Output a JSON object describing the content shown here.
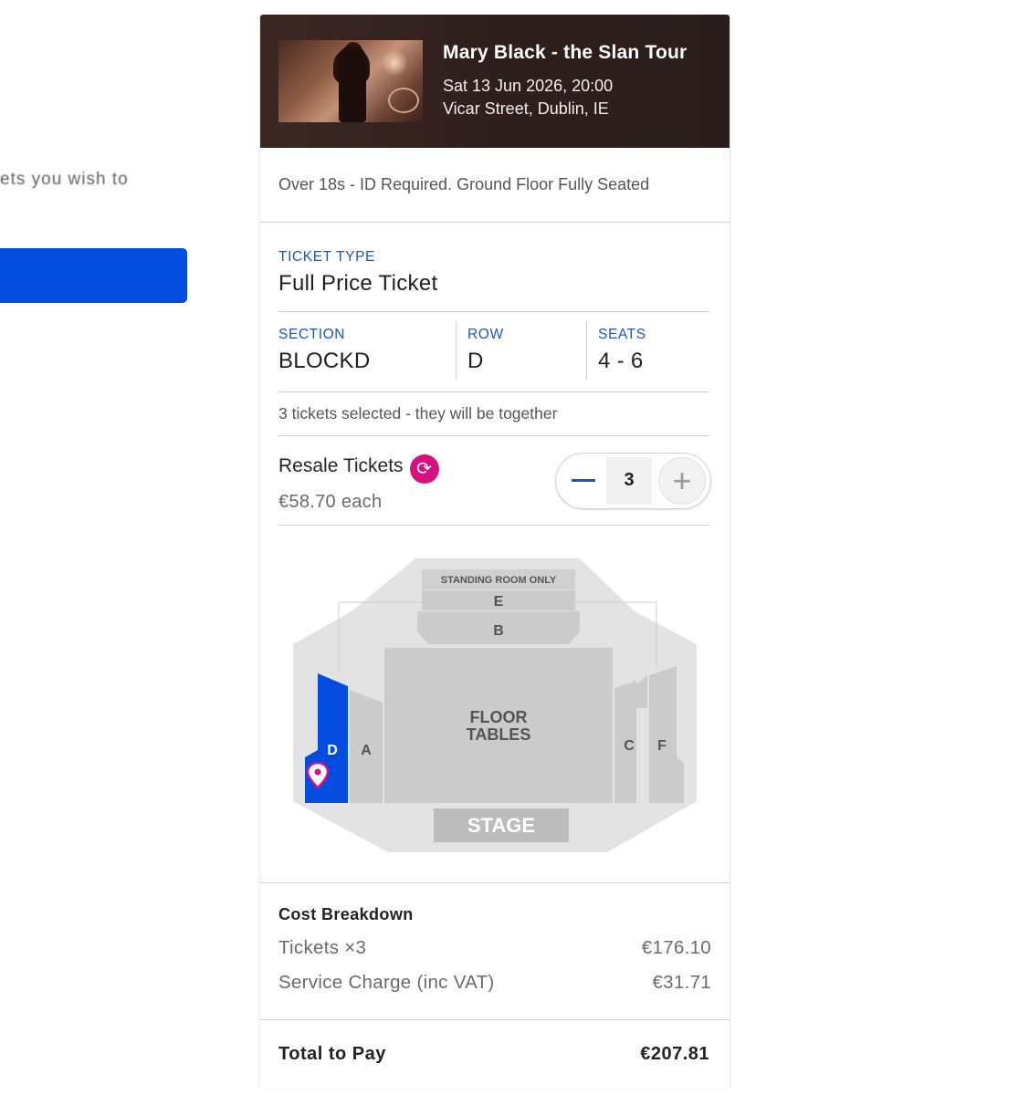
{
  "background": {
    "partial_text": "ets you wish to"
  },
  "event": {
    "title": "Mary Black - the Slan Tour",
    "date": "Sat 13 Jun 2026, 20:00",
    "venue": "Vicar Street, Dublin, IE"
  },
  "restriction": "Over 18s - ID Required. Ground Floor Fully Seated",
  "ticket": {
    "type_label": "TICKET TYPE",
    "type_value": "Full Price Ticket",
    "section_label": "SECTION",
    "section_value": "BLOCKD",
    "row_label": "ROW",
    "row_value": "D",
    "seats_label": "SEATS",
    "seats_value": "4 - 6",
    "together_text": "3 tickets selected - they will be together"
  },
  "resale": {
    "name": "Resale Tickets",
    "price": "€58.70  each",
    "quantity": "3",
    "icon": "resale-refresh-icon"
  },
  "seatmap": {
    "labels": {
      "standing": "STANDING ROOM ONLY",
      "e": "E",
      "b": "B",
      "floor1": "FLOOR",
      "floor2": "TABLES",
      "a": "A",
      "c": "C",
      "d": "D",
      "f": "F",
      "stage": "STAGE"
    },
    "selected_section": "D",
    "selected_color": "#024ddf",
    "pin_color": "#d7107f"
  },
  "cost": {
    "title": "Cost Breakdown",
    "tickets_label": "Tickets  ×3",
    "tickets_value": "€176.10",
    "service_label": "Service Charge (inc VAT)",
    "service_value": "€31.71"
  },
  "total": {
    "label": "Total to Pay",
    "value": "€207.81"
  },
  "colors": {
    "accent_blue": "#024ddf",
    "label_blue": "#1a56c2",
    "resale_pink": "#d7107f",
    "header_bg": "#2f1f1c"
  }
}
